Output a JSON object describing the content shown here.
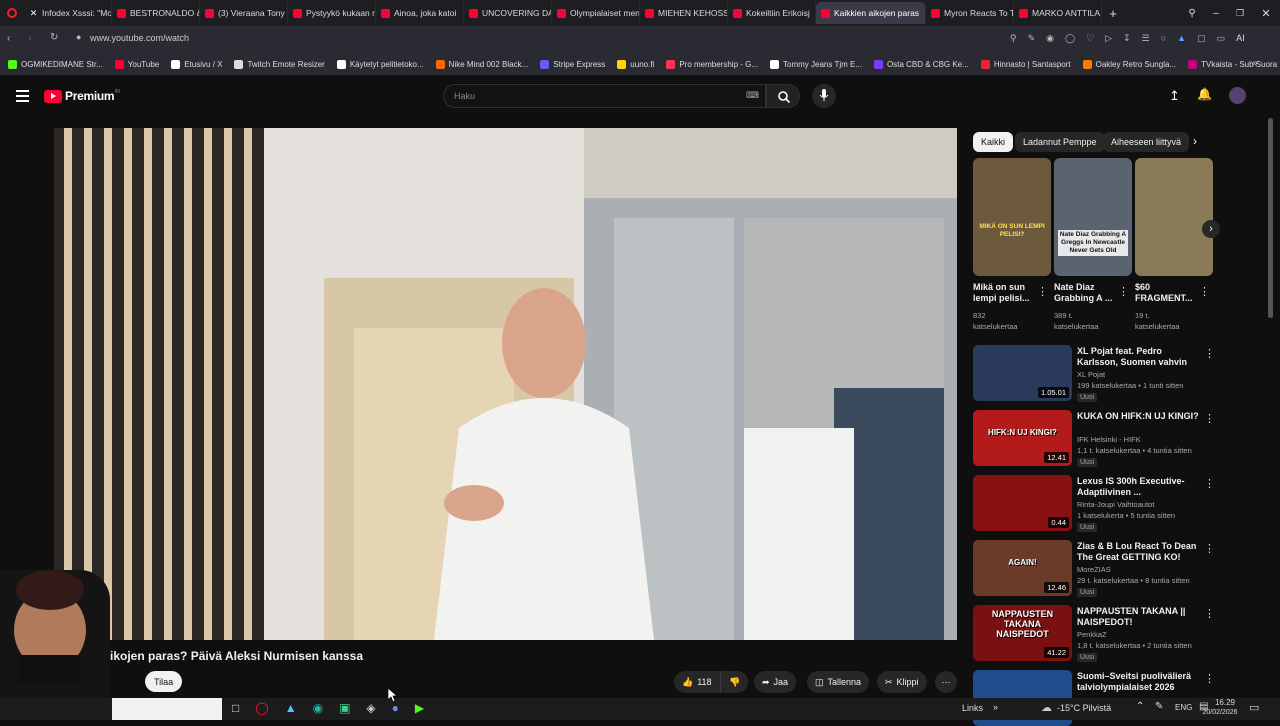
{
  "tabs": [
    {
      "label": "Infodex Xsssi: \"Mo",
      "icon": "x-icon"
    },
    {
      "label": "BESTRONALDO &",
      "icon": "youtube-icon"
    },
    {
      "label": "(3) Vieraana Tony S",
      "icon": "youtube-icon"
    },
    {
      "label": "Pystyykö kukaan n",
      "icon": "youtube-icon"
    },
    {
      "label": "Ainoa, joka katoi",
      "icon": "youtube-icon"
    },
    {
      "label": "UNCOVERING DAR",
      "icon": "youtube-icon"
    },
    {
      "label": "Olympialaiset men",
      "icon": "youtube-icon"
    },
    {
      "label": "MIEHEN KEHOSSA",
      "icon": "youtube-icon"
    },
    {
      "label": "Kokeiltiin Erikoisj",
      "icon": "youtube-icon"
    },
    {
      "label": "Kaikkien aikojen paras",
      "icon": "youtube-icon",
      "active": true
    },
    {
      "label": "Myron Reacts To Ti",
      "icon": "youtube-icon"
    },
    {
      "label": "MARKO ANTTILA H",
      "icon": "youtube-icon"
    }
  ],
  "address": {
    "url": "www.youtube.com/watch"
  },
  "bookmarks": [
    {
      "label": "OGMIKEDIMANE Str...",
      "color": "#53fc18"
    },
    {
      "label": "YouTube",
      "color": "#ff0033"
    },
    {
      "label": "Etusivu / X",
      "color": "#ffffff"
    },
    {
      "label": "Twitch Emote Resizer",
      "color": "#dddddd"
    },
    {
      "label": "Käytetyt pelitietoko...",
      "color": "#ffffff"
    },
    {
      "label": "Nike Mind 002 Black...",
      "color": "#ff6a00"
    },
    {
      "label": "Stripe Express",
      "color": "#635bff"
    },
    {
      "label": "uuno.fi",
      "color": "#ffd400"
    },
    {
      "label": "Pro membership - G...",
      "color": "#ff3355"
    },
    {
      "label": "Tommy Jeans Tjm E...",
      "color": "#ffffff"
    },
    {
      "label": "Osta CBD & CBG Ke...",
      "color": "#7a3cff"
    },
    {
      "label": "Hinnasto | Santasport",
      "color": "#e23"
    },
    {
      "label": "Oakley Retro Sungla...",
      "color": "#ff7a00"
    },
    {
      "label": "TVkaista - Sub Suora",
      "color": "#c6007e"
    }
  ],
  "masthead": {
    "logo_label": "Premium",
    "country": "FI",
    "search_placeholder": "Haku"
  },
  "chips": [
    {
      "label": "Kaikki",
      "active": true
    },
    {
      "label": "Ladannut Pemppe",
      "active": false
    },
    {
      "label": "Aiheeseen liittyvä",
      "active": false
    }
  ],
  "video": {
    "title": "Kaikkien aikojen paras? Päivä Aleksi Nurmisen kanssa",
    "title_visible": "ikojen paras? Päivä Aleksi Nurmisen kanssa",
    "subscribe_label": "Tilaa",
    "likes": "118",
    "share_label": "Jaa",
    "save_label": "Tallenna",
    "clip_label": "Klippi"
  },
  "shorts": [
    {
      "title": "Mikä on sun lempi pelisi...",
      "views": "832",
      "views_unit": "katselukertaa",
      "thumb_text": "MIKÄ ON SUN LEMPI PELISI?"
    },
    {
      "title": "Nate Diaz Grabbing A ...",
      "views": "389 t.",
      "views_unit": "katselukertaa",
      "thumb_text": "Nate Diaz Grabbing A Greggs In Newcastle Never Gets Old"
    },
    {
      "title": "$60 FRAGMENT...",
      "views": "19 t.",
      "views_unit": "katselukertaa",
      "thumb_text": ""
    }
  ],
  "related": [
    {
      "title": "XL Pojat feat. Pedro Karlsson, Suomen vahvin mies ...",
      "channel": "XL Pojat",
      "meta": "199 katselukertaa • 1 tunti sitten",
      "badge": "Uusi",
      "duration": "1.05.01",
      "thumb_color": "#2a3a5a",
      "thumb_text": ""
    },
    {
      "title": "KUKA ON HIFK:N UJ KINGI?",
      "channel": "IFK Helsinki - HIFK",
      "meta": "1,1 t. katselukertaa • 4 tuntia sitten",
      "badge": "Uusi",
      "duration": "12.41",
      "thumb_color": "#b31b1b",
      "thumb_text": "HIFK:N UJ KINGI?"
    },
    {
      "title": "Lexus IS 300h Executive-Adaptiivinen ...",
      "channel": "Rinta-Joupi Vaihtoautot",
      "meta": "1 katselukerta • 5 tuntia sitten",
      "badge": "Uusi",
      "duration": "0.44",
      "thumb_color": "#8a1111",
      "thumb_text": ""
    },
    {
      "title": "Zias & B Lou React To Dean The Great GETTING KO!",
      "channel": "MoreZIAS",
      "meta": "29 t. katselukertaa • 8 tuntia sitten",
      "badge": "Uusi",
      "duration": "12.46",
      "thumb_color": "#6b3b2a",
      "thumb_text": "AGAIN!"
    },
    {
      "title": "NAPPAUSTEN TAKANA || NAISPEDOT!",
      "channel": "PenkkaZ",
      "meta": "1,8 t. katselukertaa • 2 tuntia sitten",
      "badge": "Uusi",
      "duration": "41.22",
      "thumb_color": "#7a1010",
      "thumb_text": "NAPPAUSTEN TAKANA NAISPEDOT"
    },
    {
      "title": "Suomi–Sveitsi puolivälierä talviolympialaiset 2026",
      "channel": "",
      "meta": "",
      "badge": "",
      "duration": "",
      "thumb_color": "#1f4c8a",
      "thumb_text": ""
    }
  ],
  "taskbar": {
    "links_label": "Links",
    "weather": "-15°C Pilvistä",
    "lang": "ENG",
    "time": "16.29",
    "date": "20/02/2026"
  }
}
